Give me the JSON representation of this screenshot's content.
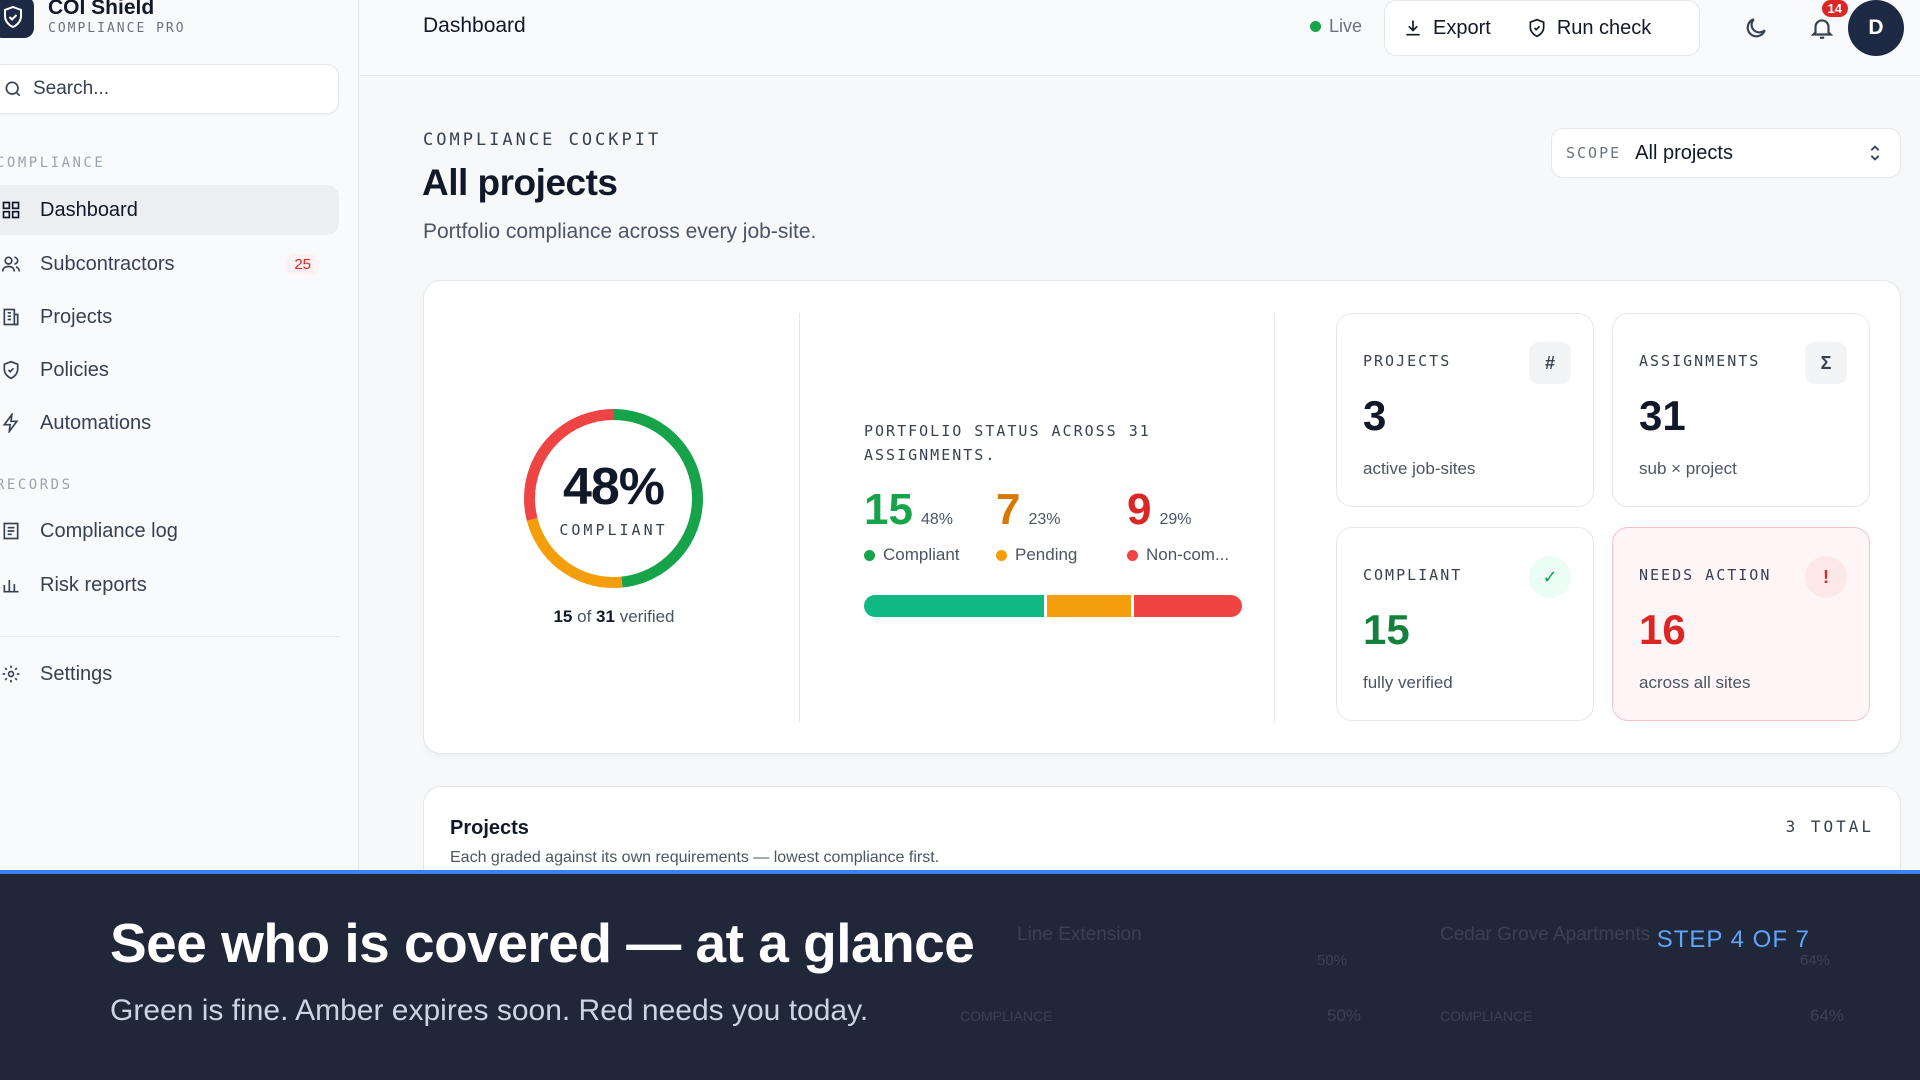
{
  "brand": {
    "title": "COI Shield",
    "subtitle": "COMPLIANCE PRO"
  },
  "sidebar": {
    "search_placeholder": "Search...",
    "section_compliance": "COMPLIANCE",
    "section_records": "RECORDS",
    "items": [
      {
        "label": "Dashboard",
        "icon": "grid-icon",
        "active": true
      },
      {
        "label": "Subcontractors",
        "icon": "users-icon",
        "badge": "25"
      },
      {
        "label": "Projects",
        "icon": "building-icon"
      },
      {
        "label": "Policies",
        "icon": "shield-check-icon"
      },
      {
        "label": "Automations",
        "icon": "bolt-icon"
      },
      {
        "label": "Compliance log",
        "icon": "list-icon"
      },
      {
        "label": "Risk reports",
        "icon": "bar-chart-icon"
      },
      {
        "label": "Settings",
        "icon": "gear-icon"
      }
    ]
  },
  "header": {
    "title": "Dashboard",
    "live": "Live",
    "export": "Export",
    "run_check": "Run check",
    "notifications": "14",
    "avatar_initial": "D"
  },
  "main": {
    "eyebrow": "COMPLIANCE COCKPIT",
    "title": "All projects",
    "subtitle": "Portfolio compliance across every job-site.",
    "scope_label": "SCOPE",
    "scope_value": "All projects"
  },
  "summary": {
    "percent": "48%",
    "percent_label": "COMPLIANT",
    "verified_count": "15",
    "verified_of": "of",
    "verified_total": "31",
    "verified_word": "verified",
    "status_heading": "PORTFOLIO STATUS ACROSS 31 ASSIGNMENTS.",
    "compliant": {
      "count": "15",
      "pct": "48%",
      "label": "Compliant",
      "value": 15
    },
    "pending": {
      "count": "7",
      "pct": "23%",
      "label": "Pending",
      "value": 7
    },
    "noncompliant": {
      "count": "9",
      "pct": "29%",
      "label": "Non-com...",
      "value": 9
    }
  },
  "kpis": [
    {
      "label": "PROJECTS",
      "value": "3",
      "sub": "active job-sites",
      "icon_glyph": "#"
    },
    {
      "label": "ASSIGNMENTS",
      "value": "31",
      "sub": "sub × project",
      "icon_glyph": "Σ"
    },
    {
      "label": "COMPLIANT",
      "value": "15",
      "sub": "fully verified",
      "icon_glyph": "✓"
    },
    {
      "label": "NEEDS ACTION",
      "value": "16",
      "sub": "across all sites",
      "icon_glyph": "!"
    }
  ],
  "projects": {
    "title": "Projects",
    "subtitle": "Each graded against its own requirements — lowest compliance first.",
    "total": "3 TOTAL",
    "ghost_row": [
      "Line Extension",
      "Cedar Grove Apartments",
      "50%",
      "64%",
      "COMPLIANCE",
      "COMPLIANCE",
      "50%",
      "64%"
    ]
  },
  "overlay": {
    "title": "See who is covered — at a glance",
    "subtitle": "Green is fine. Amber expires soon. Red needs you today.",
    "step": "STEP 4 OF 7"
  },
  "colors": {
    "green": "#16a34a",
    "amber": "#f59e0b",
    "red": "#ef4444",
    "navy": "#1e2a44"
  }
}
